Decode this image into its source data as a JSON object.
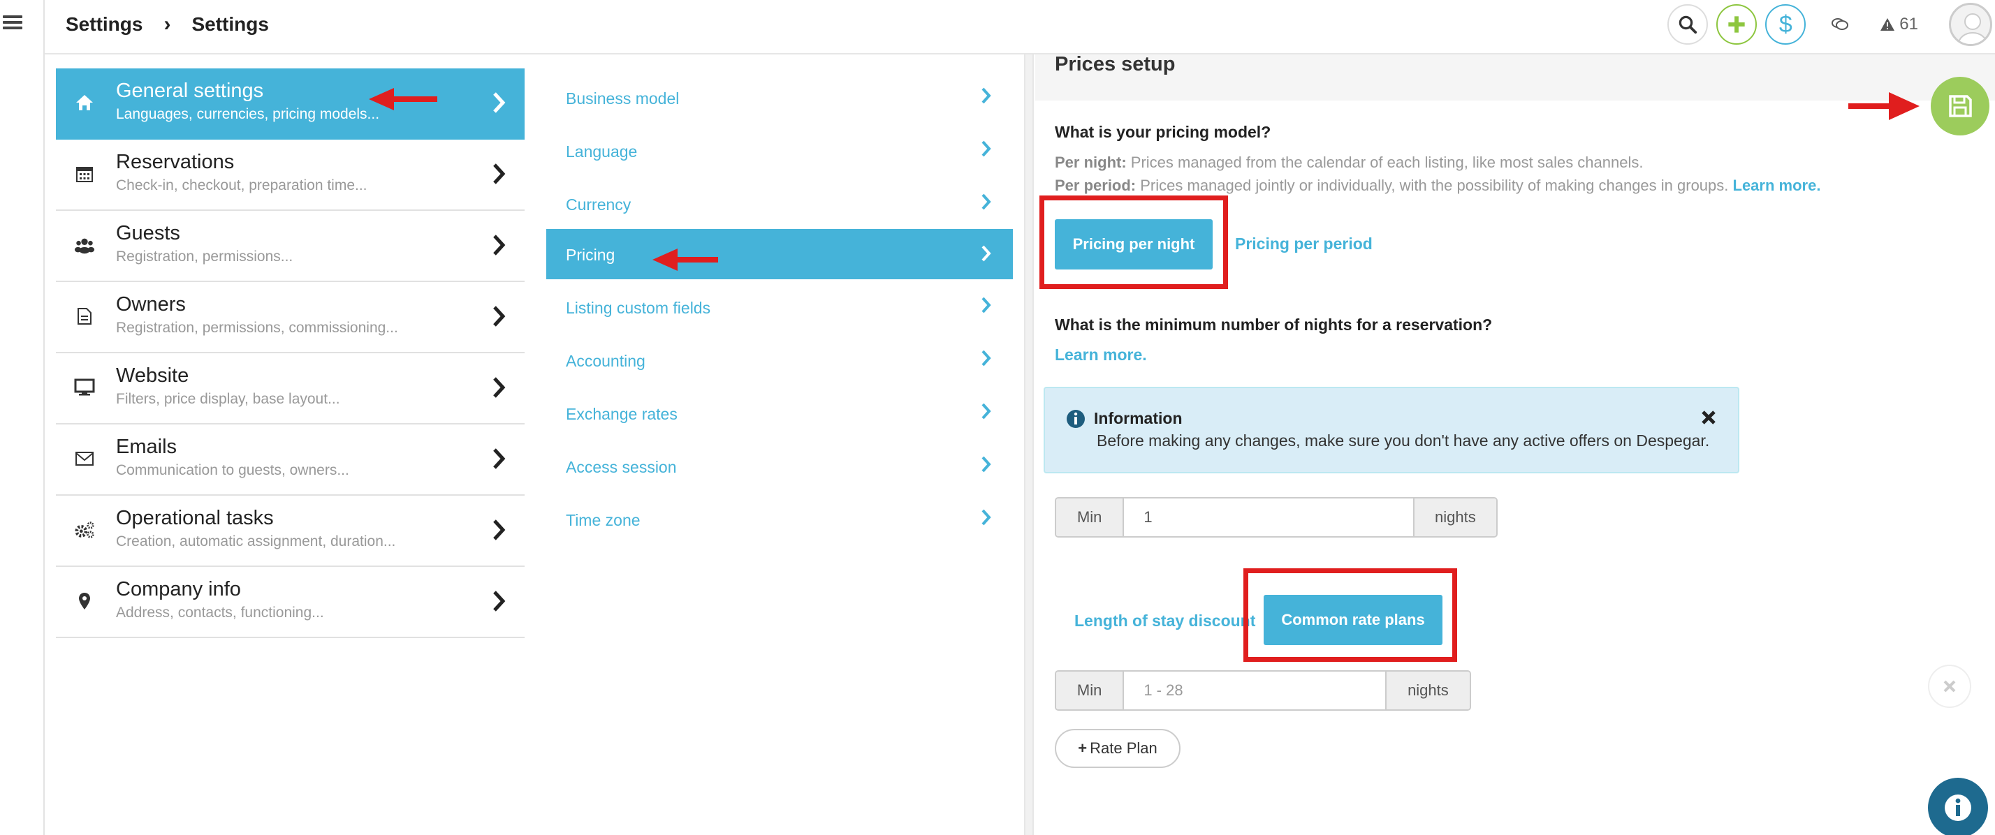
{
  "breadcrumb": {
    "root": "Settings",
    "current": "Settings"
  },
  "topbar": {
    "alert_count": "61"
  },
  "categories": [
    {
      "title": "General settings",
      "subtitle": "Languages, currencies, pricing models...",
      "icon": "home-icon"
    },
    {
      "title": "Reservations",
      "subtitle": "Check-in, checkout, preparation time...",
      "icon": "calendar-icon"
    },
    {
      "title": "Guests",
      "subtitle": "Registration, permissions...",
      "icon": "users-icon"
    },
    {
      "title": "Owners",
      "subtitle": "Registration, permissions, commissioning...",
      "icon": "document-icon"
    },
    {
      "title": "Website",
      "subtitle": "Filters, price display, base layout...",
      "icon": "monitor-icon"
    },
    {
      "title": "Emails",
      "subtitle": "Communication to guests, owners...",
      "icon": "envelope-icon"
    },
    {
      "title": "Operational tasks",
      "subtitle": "Creation, automatic assignment, duration...",
      "icon": "gears-icon"
    },
    {
      "title": "Company info",
      "subtitle": "Address, contacts, functioning...",
      "icon": "map-pin-icon"
    }
  ],
  "subitems": [
    "Business model",
    "Language",
    "Currency",
    "Pricing",
    "Listing custom fields",
    "Accounting",
    "Exchange rates",
    "Access session",
    "Time zone"
  ],
  "panel": {
    "title": "Prices setup",
    "q_pricing_model": "What is your pricing model?",
    "per_night_label": "Per night:",
    "per_night_text": " Prices managed from the calendar of each listing, like most sales channels.",
    "per_period_label": "Per period:",
    "per_period_text": " Prices managed jointly or individually, with the possibility of making changes in groups. ",
    "learn_more": "Learn more.",
    "btn_per_night": "Pricing per night",
    "link_per_period": "Pricing per period",
    "q_min_nights": "What is the minimum number of nights for a reservation?",
    "learn_more_2": "Learn more.",
    "info_title": "Information",
    "info_text": "Before making any changes, make sure you don't have any active offers on Despegar.",
    "min_label": "Min",
    "min_value": "1",
    "nights_label": "nights",
    "link_length_stay": "Length of stay discount",
    "btn_common_rate": "Common rate plans",
    "min_label_2": "Min",
    "range_placeholder": "1 - 28",
    "nights_label_2": "nights",
    "rate_plan_btn": "Rate Plan",
    "rate_plan_plus": "+"
  },
  "colors": {
    "accent": "#45b3d9",
    "save": "#9ccc5c",
    "annotation_red": "#e01e1e",
    "info_bg": "#d9edf7"
  }
}
